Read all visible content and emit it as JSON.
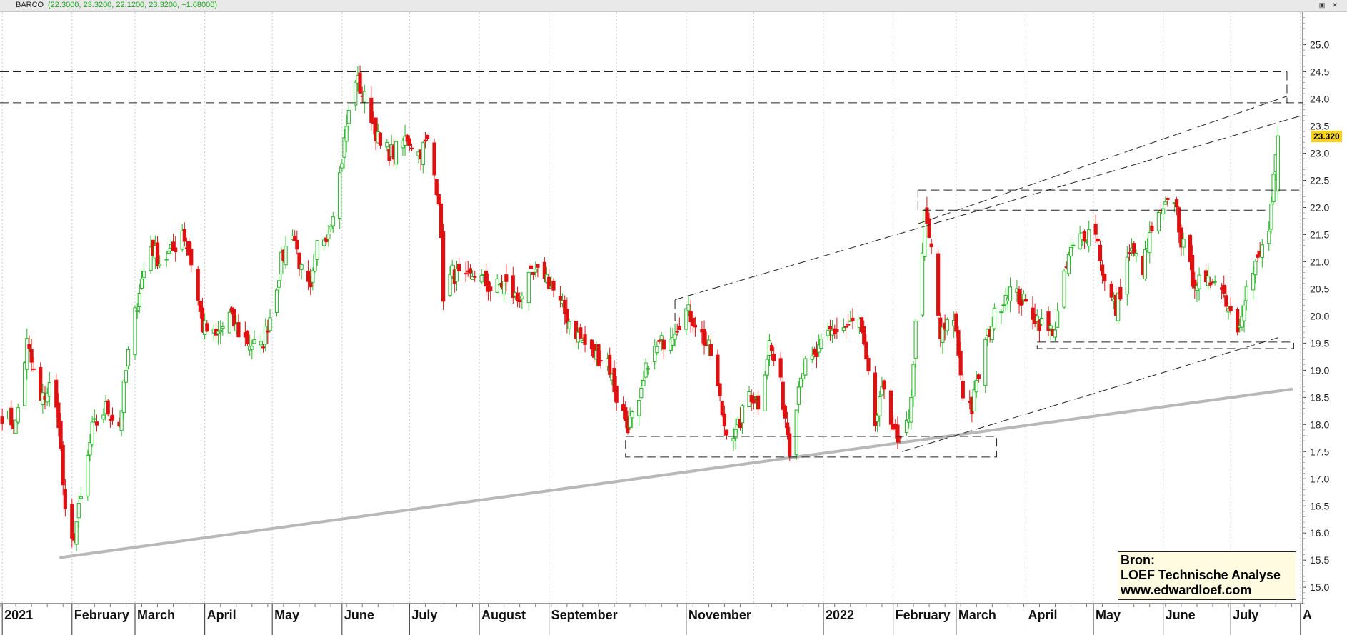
{
  "window": {
    "symbol": "BARCO",
    "ohlc_text": "(22.3000, 23.3200, 22.1200, 23.3200, +1.68000)"
  },
  "last_price_label": "23.320",
  "source": {
    "line1": "Bron:",
    "line2": "LOEF Technische Analyse",
    "line3": "www.edwardloef.com"
  },
  "colors": {
    "up": "#22b822",
    "down": "#e01010",
    "trendline_gray": "#b8b8b8",
    "dashed_lines": "#222222",
    "price_tag": "#ffd21a"
  },
  "chart_data": {
    "type": "candlestick",
    "title": "BARCO",
    "ylim": [
      14.7,
      25.6
    ],
    "yticks": [
      15.0,
      15.5,
      16.0,
      16.5,
      17.0,
      17.5,
      18.0,
      18.5,
      19.0,
      19.5,
      20.0,
      20.5,
      21.0,
      21.5,
      22.0,
      22.5,
      23.0,
      23.5,
      24.0,
      24.5,
      25.0
    ],
    "xlim": [
      "2020-12-31",
      "2022-08-02"
    ],
    "x_labels": [
      {
        "date": "2021-01-01",
        "label": "2021"
      },
      {
        "date": "2021-02-01",
        "label": "February"
      },
      {
        "date": "2021-03-01",
        "label": "March"
      },
      {
        "date": "2021-04-01",
        "label": "April"
      },
      {
        "date": "2021-05-01",
        "label": "May"
      },
      {
        "date": "2021-06-01",
        "label": "June"
      },
      {
        "date": "2021-07-01",
        "label": "July"
      },
      {
        "date": "2021-08-01",
        "label": "August"
      },
      {
        "date": "2021-09-01",
        "label": "September"
      },
      {
        "date": "2021-11-01",
        "label": "November"
      },
      {
        "date": "2022-01-01",
        "label": "2022"
      },
      {
        "date": "2022-02-01",
        "label": "February"
      },
      {
        "date": "2022-03-01",
        "label": "March"
      },
      {
        "date": "2022-04-01",
        "label": "April"
      },
      {
        "date": "2022-05-01",
        "label": "May"
      },
      {
        "date": "2022-06-01",
        "label": "June"
      },
      {
        "date": "2022-07-01",
        "label": "July"
      },
      {
        "date": "2022-08-01",
        "label": "A"
      }
    ],
    "x_gridlines": [
      "2021-01-01",
      "2021-02-01",
      "2021-03-01",
      "2021-04-01",
      "2021-05-01",
      "2021-06-01",
      "2021-07-01",
      "2021-08-01",
      "2021-09-01",
      "2021-10-01",
      "2021-11-01",
      "2021-12-01",
      "2022-01-01",
      "2022-02-01",
      "2022-03-01",
      "2022-04-01",
      "2022-05-01",
      "2022-06-01",
      "2022-07-01",
      "2022-08-01"
    ],
    "grid": true,
    "anchors": [
      [
        "2021-01-01",
        18.2
      ],
      [
        "2021-01-07",
        18.0
      ],
      [
        "2021-01-12",
        19.5
      ],
      [
        "2021-01-18",
        18.4
      ],
      [
        "2021-01-22",
        18.7
      ],
      [
        "2021-01-26",
        18.1
      ],
      [
        "2021-01-29",
        16.3
      ],
      [
        "2021-02-01",
        15.8
      ],
      [
        "2021-02-05",
        16.6
      ],
      [
        "2021-02-10",
        17.9
      ],
      [
        "2021-02-16",
        18.3
      ],
      [
        "2021-02-22",
        18.0
      ],
      [
        "2021-02-26",
        19.3
      ],
      [
        "2021-03-03",
        20.5
      ],
      [
        "2021-03-08",
        21.3
      ],
      [
        "2021-03-12",
        21.0
      ],
      [
        "2021-03-18",
        21.2
      ],
      [
        "2021-03-22",
        21.6
      ],
      [
        "2021-03-26",
        21.0
      ],
      [
        "2021-03-31",
        19.8
      ],
      [
        "2021-04-06",
        19.6
      ],
      [
        "2021-04-12",
        20.0
      ],
      [
        "2021-04-16",
        19.7
      ],
      [
        "2021-04-21",
        19.5
      ],
      [
        "2021-04-26",
        19.4
      ],
      [
        "2021-04-30",
        20.0
      ],
      [
        "2021-05-05",
        21.0
      ],
      [
        "2021-05-10",
        21.6
      ],
      [
        "2021-05-14",
        20.8
      ],
      [
        "2021-05-18",
        20.4
      ],
      [
        "2021-05-21",
        21.3
      ],
      [
        "2021-05-26",
        21.6
      ],
      [
        "2021-05-31",
        22.6
      ],
      [
        "2021-06-03",
        23.5
      ],
      [
        "2021-06-07",
        24.4
      ],
      [
        "2021-06-10",
        24.1
      ],
      [
        "2021-06-14",
        23.7
      ],
      [
        "2021-06-18",
        23.1
      ],
      [
        "2021-06-24",
        23.0
      ],
      [
        "2021-06-30",
        23.3
      ],
      [
        "2021-07-05",
        23.0
      ],
      [
        "2021-07-09",
        23.2
      ],
      [
        "2021-07-14",
        22.2
      ],
      [
        "2021-07-16",
        20.4
      ],
      [
        "2021-07-20",
        20.8
      ],
      [
        "2021-07-26",
        20.6
      ],
      [
        "2021-07-30",
        20.8
      ],
      [
        "2021-08-06",
        20.5
      ],
      [
        "2021-08-12",
        20.6
      ],
      [
        "2021-08-18",
        20.3
      ],
      [
        "2021-08-24",
        20.7
      ],
      [
        "2021-08-30",
        20.8
      ],
      [
        "2021-09-06",
        20.2
      ],
      [
        "2021-09-13",
        19.7
      ],
      [
        "2021-09-20",
        19.3
      ],
      [
        "2021-09-27",
        19.2
      ],
      [
        "2021-10-01",
        18.5
      ],
      [
        "2021-10-06",
        18.0
      ],
      [
        "2021-10-11",
        18.3
      ],
      [
        "2021-10-15",
        19.2
      ],
      [
        "2021-10-21",
        19.5
      ],
      [
        "2021-10-27",
        19.8
      ],
      [
        "2021-11-01",
        20.1
      ],
      [
        "2021-11-05",
        19.9
      ],
      [
        "2021-11-12",
        19.3
      ],
      [
        "2021-11-18",
        18.0
      ],
      [
        "2021-11-23",
        17.8
      ],
      [
        "2021-11-29",
        18.6
      ],
      [
        "2021-12-03",
        18.4
      ],
      [
        "2021-12-08",
        19.5
      ],
      [
        "2021-12-13",
        18.7
      ],
      [
        "2021-12-17",
        17.6
      ],
      [
        "2021-12-22",
        19.0
      ],
      [
        "2021-12-28",
        19.2
      ],
      [
        "2022-01-04",
        19.7
      ],
      [
        "2022-01-11",
        19.8
      ],
      [
        "2022-01-17",
        19.9
      ],
      [
        "2022-01-24",
        18.0
      ],
      [
        "2022-01-28",
        18.7
      ],
      [
        "2022-02-03",
        17.6
      ],
      [
        "2022-02-08",
        18.0
      ],
      [
        "2022-02-11",
        19.8
      ],
      [
        "2022-02-15",
        21.8
      ],
      [
        "2022-02-18",
        21.2
      ],
      [
        "2022-02-22",
        19.6
      ],
      [
        "2022-02-28",
        20.0
      ],
      [
        "2022-03-04",
        18.6
      ],
      [
        "2022-03-08",
        18.3
      ],
      [
        "2022-03-14",
        19.5
      ],
      [
        "2022-03-18",
        20.0
      ],
      [
        "2022-03-24",
        20.5
      ],
      [
        "2022-03-30",
        20.3
      ],
      [
        "2022-04-05",
        20.0
      ],
      [
        "2022-04-11",
        19.7
      ],
      [
        "2022-04-14",
        19.8
      ],
      [
        "2022-04-20",
        21.1
      ],
      [
        "2022-04-26",
        21.5
      ],
      [
        "2022-05-02",
        21.6
      ],
      [
        "2022-05-06",
        20.6
      ],
      [
        "2022-05-11",
        20.1
      ],
      [
        "2022-05-17",
        21.2
      ],
      [
        "2022-05-23",
        20.9
      ],
      [
        "2022-05-27",
        21.6
      ],
      [
        "2022-06-01",
        21.9
      ],
      [
        "2022-06-06",
        22.2
      ],
      [
        "2022-06-09",
        21.4
      ],
      [
        "2022-06-14",
        20.7
      ],
      [
        "2022-06-20",
        20.5
      ],
      [
        "2022-06-24",
        20.8
      ],
      [
        "2022-06-29",
        20.3
      ],
      [
        "2022-07-04",
        19.8
      ],
      [
        "2022-07-08",
        20.5
      ],
      [
        "2022-07-13",
        21.0
      ],
      [
        "2022-07-18",
        21.6
      ],
      [
        "2022-07-22",
        23.3
      ]
    ],
    "overlays": {
      "long_term_trendline": [
        [
          "2021-01-27",
          15.55
        ],
        [
          "2022-07-28",
          18.65
        ]
      ],
      "channel_upper": [
        [
          "2021-10-27",
          20.3
        ],
        [
          "2022-08-02",
          23.7
        ]
      ],
      "channel_lower": [
        [
          "2022-02-05",
          17.5
        ],
        [
          "2022-07-22",
          19.6
        ]
      ],
      "upper_rising": [
        [
          "2022-02-12",
          21.7
        ],
        [
          "2022-07-26",
          24.05
        ]
      ],
      "horizontal_levels": [
        {
          "y": 24.5,
          "from": "2020-12-31",
          "to": "2022-07-26"
        },
        {
          "y": 23.93,
          "from": "2020-12-31",
          "to": "2022-08-02"
        },
        {
          "y": 22.32,
          "from": "2022-02-12",
          "to": "2022-08-02"
        },
        {
          "y": 21.95,
          "from": "2022-02-14",
          "to": "2022-07-18"
        }
      ],
      "support_box_1": {
        "x0": "2021-10-05",
        "x1": "2022-03-19",
        "y0": 17.4,
        "y1": 17.78
      },
      "support_box_2": {
        "x0": "2022-04-06",
        "x1": "2022-07-29",
        "y0": 19.4,
        "y1": 19.52
      }
    }
  }
}
